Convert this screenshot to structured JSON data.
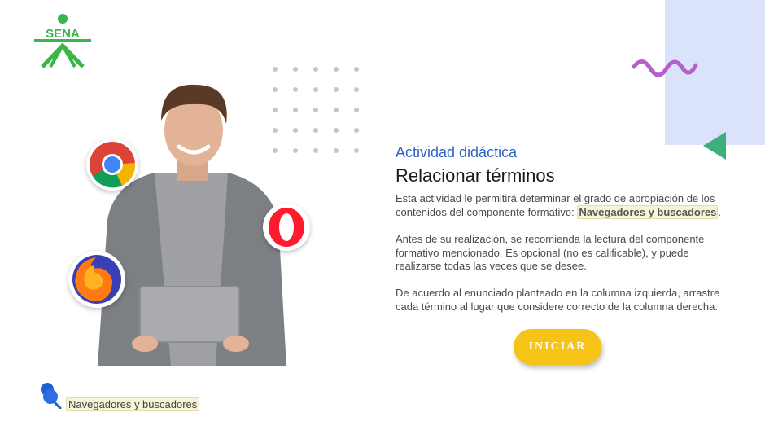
{
  "logo": {
    "text": "SENA",
    "color": "#39b54a"
  },
  "hero": {
    "icons": [
      "chrome-icon",
      "opera-icon",
      "firefox-icon"
    ]
  },
  "content": {
    "kicker": "Actividad didáctica",
    "title": "Relacionar términos",
    "p1_prefix": "Esta actividad le permitirá determinar el grado de apropiación de los contenidos del componente formativo: ",
    "p1_highlight": "Navegadores y buscadores",
    "p1_suffix": ".",
    "p2": "Antes de su realización, se recomienda la lectura del componente formativo mencionado.  Es opcional (no es calificable), y puede realizarse todas las veces que se desee.",
    "p3": "De acuerdo al enunciado planteado en la columna izquierda, arrastre cada término al lugar que considere correcto de la columna derecha."
  },
  "button": {
    "label": "INICIAR",
    "color": "#f5c417"
  },
  "footer": {
    "tag": "Navegadores y buscadores"
  },
  "colors": {
    "accent_blue": "#2e63c6",
    "panel_blue": "#dbe3fc",
    "squiggle": "#b561c9",
    "triangle": "#3bb07a"
  }
}
